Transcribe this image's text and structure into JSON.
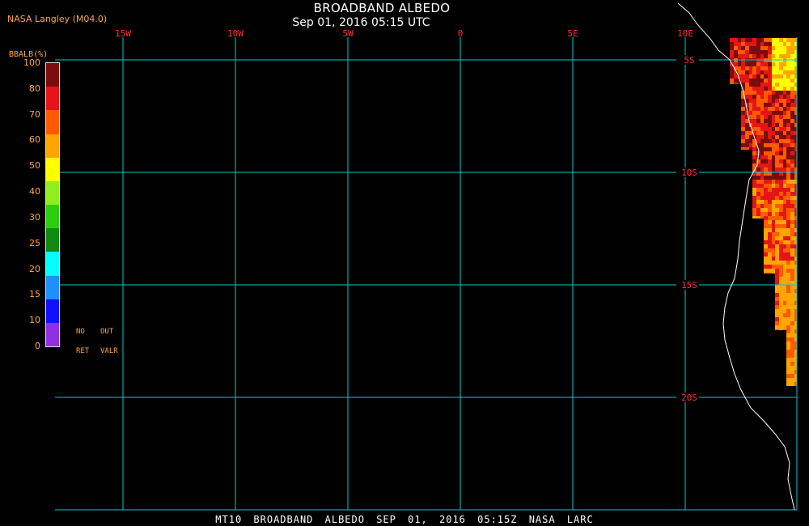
{
  "header": {
    "credit": "NASA Langley (M04.0)",
    "title": "BROADBAND ALBEDO",
    "subtitle": "Sep 01, 2016 05:15 UTC"
  },
  "footer": {
    "caption": "MT10  BROADBAND ALBEDO  SEP 01, 2016 05:15Z  NASA LARC"
  },
  "colorbar": {
    "title": "BBALB(%)",
    "labels": [
      "100",
      "80",
      "70",
      "60",
      "50",
      "40",
      "30",
      "25",
      "20",
      "15",
      "10",
      "0"
    ],
    "colors": [
      "#7a0c0c",
      "#e51515",
      "#ff5a00",
      "#ffa500",
      "#ffff00",
      "#90ee20",
      "#2ecc10",
      "#108a10",
      "#00ffff",
      "#1e90ff",
      "#1010ff",
      "#9030e0"
    ],
    "notes": [
      "NO",
      "OUT",
      "RET",
      "VALR"
    ]
  },
  "grid": {
    "color": "#00cccc",
    "label_color": "#ff3030",
    "lon_labels": [
      "15W",
      "10W",
      "5W",
      "0",
      "5E",
      "10E"
    ],
    "lat_labels": [
      "5S",
      "10S",
      "15S",
      "20S"
    ],
    "lon_values": [
      -15,
      -10,
      -5,
      0,
      5,
      10
    ],
    "lat_values": [
      -5,
      -10,
      -15,
      -20
    ]
  },
  "map": {
    "coastline_color": "#ffffff",
    "albedo_swath_colors": [
      "#7a0c0c",
      "#e51515",
      "#ff5a00",
      "#ffa500",
      "#ffff00"
    ]
  }
}
